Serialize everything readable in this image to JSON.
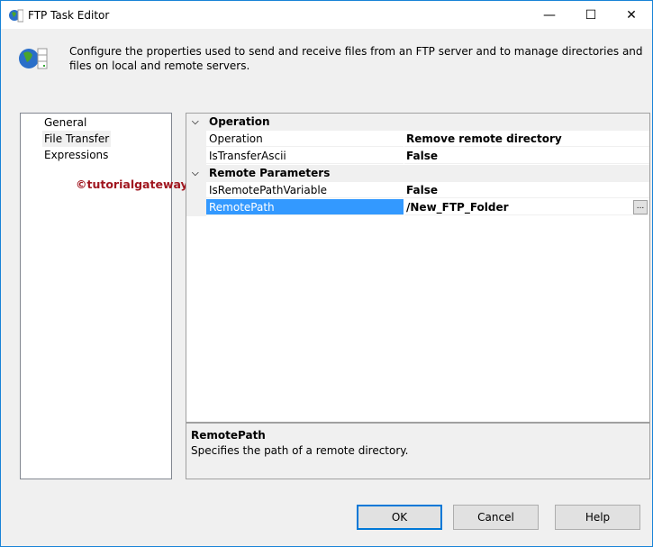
{
  "window": {
    "title": "FTP Task Editor",
    "minimize": "—",
    "maximize": "☐",
    "close": "✕"
  },
  "header": {
    "description": "Configure the properties used to send and receive files from an FTP server and to manage directories and files on local and remote servers."
  },
  "nav": {
    "items": [
      {
        "label": "General"
      },
      {
        "label": "File Transfer",
        "selected": true
      },
      {
        "label": "Expressions"
      }
    ],
    "watermark": "©tutorialgateway.org"
  },
  "grid": {
    "categories": [
      {
        "name": "Operation",
        "props": [
          {
            "name": "Operation",
            "value": "Remove remote directory"
          },
          {
            "name": "IsTransferAscii",
            "value": "False"
          }
        ]
      },
      {
        "name": "Remote Parameters",
        "props": [
          {
            "name": "IsRemotePathVariable",
            "value": "False"
          },
          {
            "name": "RemotePath",
            "value": "/New_FTP_Folder",
            "selected": true,
            "ellipsis": "..."
          }
        ]
      }
    ]
  },
  "help": {
    "title": "RemotePath",
    "text": "Specifies the path of a remote directory."
  },
  "buttons": {
    "ok": "OK",
    "cancel": "Cancel",
    "help": "Help"
  }
}
